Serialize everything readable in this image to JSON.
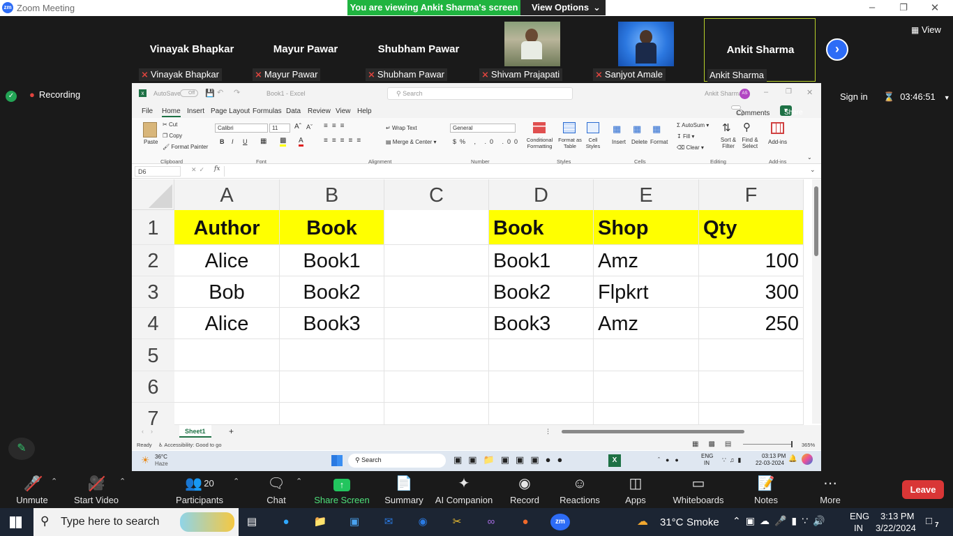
{
  "titlebar": {
    "app_title": "Zoom Meeting",
    "viewing_text": "You are viewing Ankit Sharma's screen",
    "view_options": "View Options"
  },
  "participants": [
    {
      "display": "Vinayak Bhapkar",
      "label": "Vinayak Bhapkar",
      "muted": true
    },
    {
      "display": "Mayur Pawar",
      "label": "Mayur Pawar",
      "muted": true
    },
    {
      "display": "Shubham Pawar",
      "label": "Shubham Pawar",
      "muted": true
    },
    {
      "display": "",
      "label": "Shivam Prajapati",
      "muted": true
    },
    {
      "display": "",
      "label": "Sanjyot Amale",
      "muted": true
    },
    {
      "display": "Ankit Sharma",
      "label": "Ankit Sharma",
      "muted": false
    }
  ],
  "view_label": "View",
  "recording_label": "Recording",
  "sign_in": "Sign in",
  "timer": "03:46:51",
  "excel": {
    "autosave": "AutoSave",
    "autosave_state": "Off",
    "doc_title": "Book1 - Excel",
    "search_placeholder": "Search",
    "user": "Ankit Sharma",
    "user_initials": "AS",
    "menu": [
      "File",
      "Home",
      "Insert",
      "Page Layout",
      "Formulas",
      "Data",
      "Review",
      "View",
      "Help"
    ],
    "comments": "Comments",
    "share": "Share",
    "ribbon": {
      "paste": "Paste",
      "cut": "Cut",
      "copy": "Copy",
      "format_painter": "Format Painter",
      "clipboard": "Clipboard",
      "font_name": "Calibri",
      "font_size": "11",
      "font_group": "Font",
      "wrap_text": "Wrap Text",
      "merge_center": "Merge & Center",
      "alignment": "Alignment",
      "number_format": "General",
      "number": "Number",
      "conditional": "Conditional Formatting",
      "format_table": "Format as Table",
      "cell_styles": "Cell Styles",
      "styles": "Styles",
      "insert": "Insert",
      "delete": "Delete",
      "format": "Format",
      "cells": "Cells",
      "autosum": "AutoSum",
      "fill": "Fill",
      "clear": "Clear",
      "sort_filter": "Sort & Filter",
      "find_select": "Find & Select",
      "editing": "Editing",
      "addins": "Add-ins",
      "addins_group": "Add-ins"
    },
    "name_box": "D6",
    "columns": [
      "A",
      "B",
      "C",
      "D",
      "E",
      "F"
    ],
    "rows": [
      "1",
      "2",
      "3",
      "4",
      "5",
      "6",
      "7"
    ],
    "cells": {
      "A1": "Author",
      "B1": "Book",
      "D1": "Book",
      "E1": "Shop",
      "F1": "Qty",
      "A2": "Alice",
      "B2": "Book1",
      "D2": "Book1",
      "E2": "Amz",
      "F2": "100",
      "A3": "Bob",
      "B3": "Book2",
      "D3": "Book2",
      "E3": "Flpkrt",
      "F3": "300",
      "A4": "Alice",
      "B4": "Book3",
      "D4": "Book3",
      "E4": "Amz",
      "F4": "250"
    },
    "sheet_tab": "Sheet1",
    "status_ready": "Ready",
    "status_accessibility": "Accessibility: Good to go",
    "zoom": "365%",
    "remote_weather_temp": "36°C",
    "remote_weather_desc": "Haze",
    "remote_search": "Search",
    "remote_lang": "ENG",
    "remote_region": "IN",
    "remote_time": "03:13 PM",
    "remote_date": "22-03-2024"
  },
  "toolbar": {
    "unmute": "Unmute",
    "start_video": "Start Video",
    "participants": "Participants",
    "participant_count": "20",
    "chat": "Chat",
    "share_screen": "Share Screen",
    "summary": "Summary",
    "ai_companion": "AI Companion",
    "record": "Record",
    "reactions": "Reactions",
    "apps": "Apps",
    "whiteboards": "Whiteboards",
    "notes": "Notes",
    "more": "More",
    "leave": "Leave"
  },
  "taskbar": {
    "search_placeholder": "Type here to search",
    "weather_temp": "31°C",
    "weather_desc": "Smoke",
    "lang": "ENG",
    "region": "IN",
    "time": "3:13 PM",
    "date": "3/22/2024",
    "notifications": "7"
  }
}
